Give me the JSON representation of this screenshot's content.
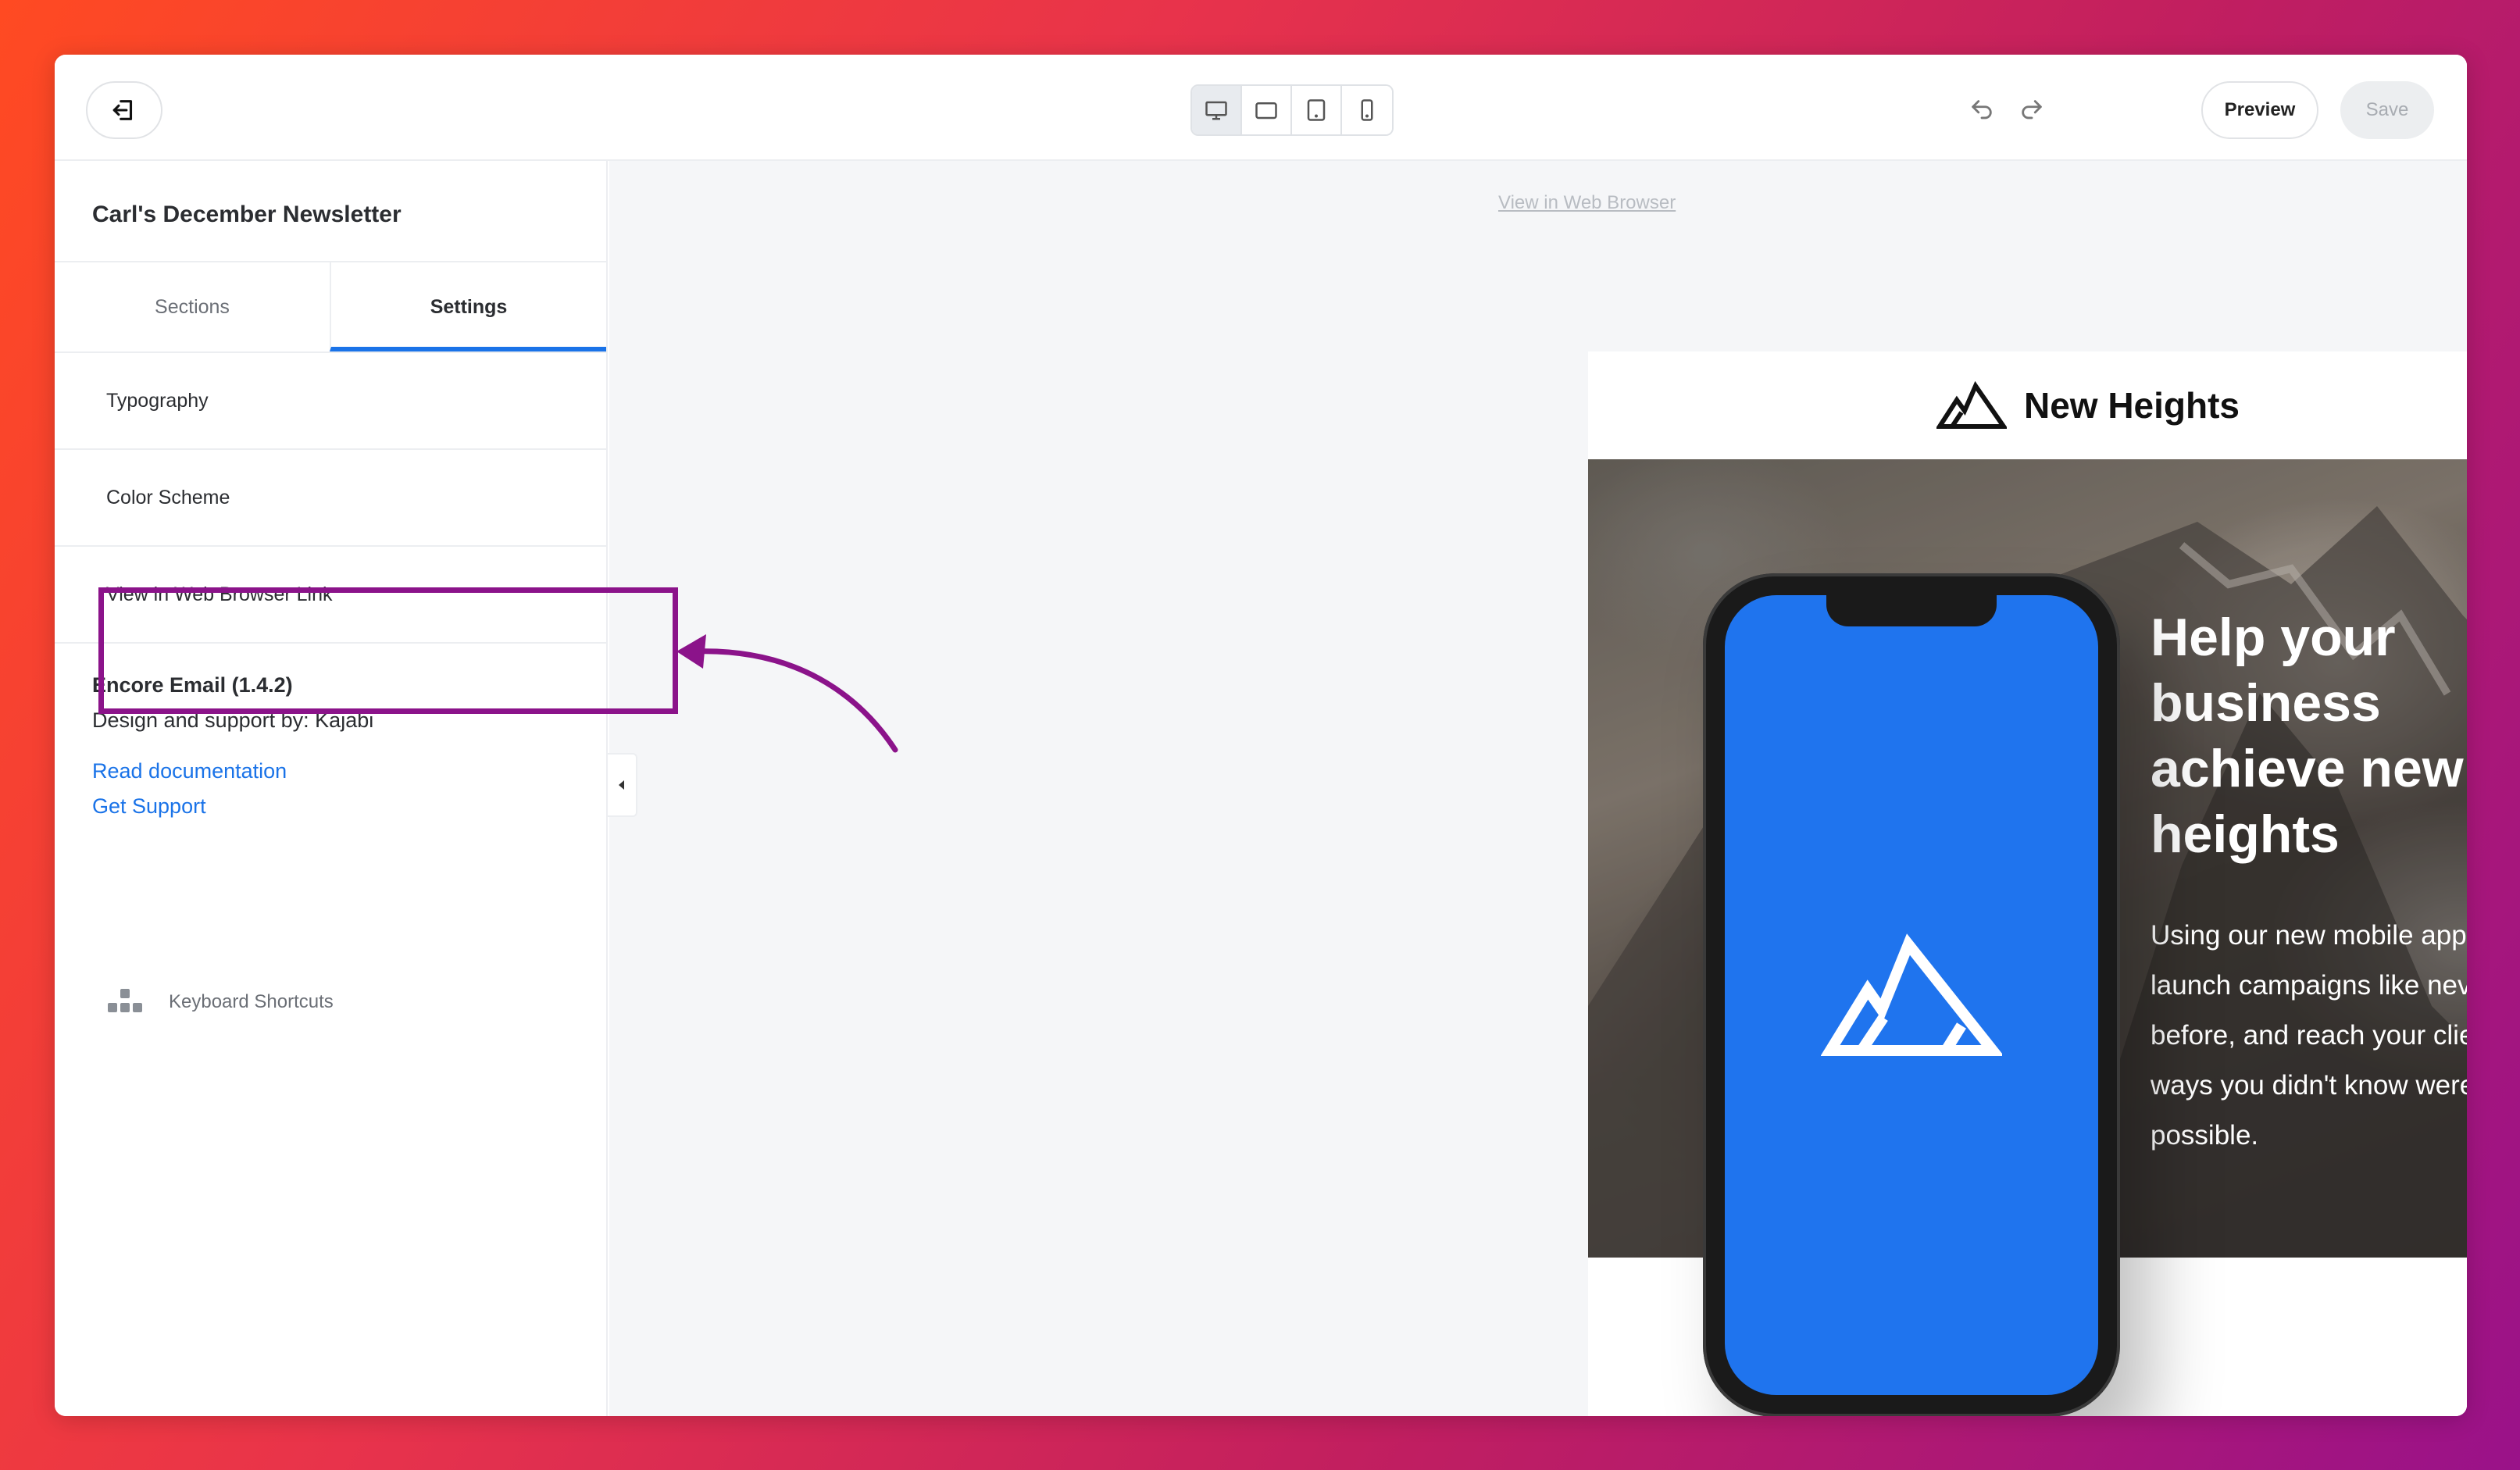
{
  "toolbar": {
    "exit_icon": "exit-icon",
    "device_icons": [
      "desktop-icon",
      "tablet-landscape-icon",
      "tablet-portrait-icon",
      "mobile-icon"
    ],
    "active_device": "desktop",
    "preview_label": "Preview",
    "save_label": "Save"
  },
  "sidebar": {
    "title": "Carl's December Newsletter",
    "tabs": [
      {
        "label": "Sections",
        "active": false
      },
      {
        "label": "Settings",
        "active": true
      }
    ],
    "settings_items": [
      {
        "label": "Typography"
      },
      {
        "label": "Color Scheme"
      },
      {
        "label": "View in Web Browser Link"
      }
    ],
    "theme_name": "Encore Email (1.4.2)",
    "theme_support": "Design and support by: Kajabi",
    "links": {
      "documentation": "Read documentation",
      "support": "Get Support"
    },
    "shortcuts_label": "Keyboard Shortcuts"
  },
  "email": {
    "view_link": "View in Web Browser",
    "brand_name": "New Heights",
    "hero_title": "Help your business achieve new heights",
    "hero_text": "Using our new mobile app, launch campaigns like never before, and reach your clients in ways you didn't know were possible."
  },
  "colors": {
    "accent": "#1a73e8",
    "highlight": "#8b138a",
    "phone_screen": "#1f74ee"
  }
}
